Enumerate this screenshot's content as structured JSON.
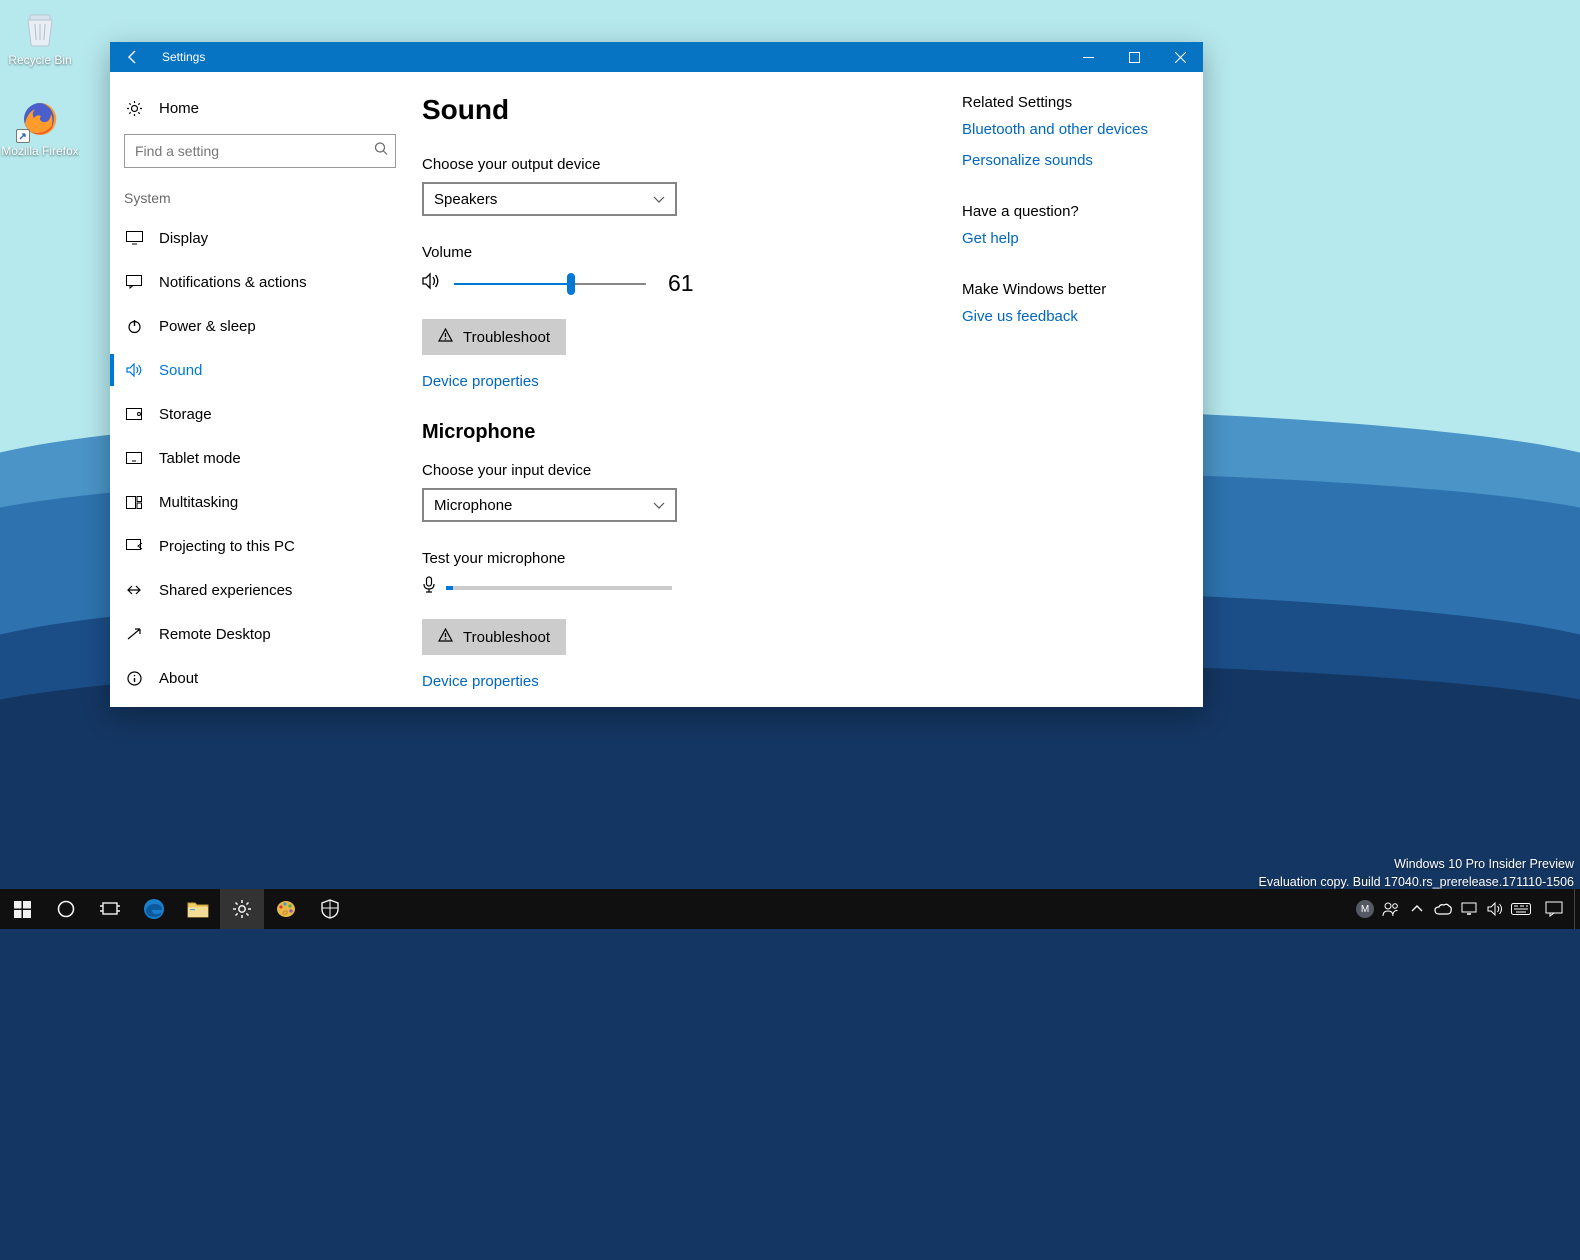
{
  "desktop": {
    "icons": {
      "recycle_bin": "Recycle Bin",
      "firefox": "Mozilla Firefox"
    },
    "watermark_line1": "Windows 10 Pro Insider Preview",
    "watermark_line2": "Evaluation copy. Build 17040.rs_prerelease.171110-1506"
  },
  "window": {
    "title": "Settings"
  },
  "sidebar": {
    "home": "Home",
    "search_placeholder": "Find a setting",
    "section": "System",
    "items": [
      {
        "label": "Display"
      },
      {
        "label": "Notifications & actions"
      },
      {
        "label": "Power & sleep"
      },
      {
        "label": "Sound"
      },
      {
        "label": "Storage"
      },
      {
        "label": "Tablet mode"
      },
      {
        "label": "Multitasking"
      },
      {
        "label": "Projecting to this PC"
      },
      {
        "label": "Shared experiences"
      },
      {
        "label": "Remote Desktop"
      },
      {
        "label": "About"
      }
    ]
  },
  "main": {
    "title": "Sound",
    "output_label": "Choose your output device",
    "output_value": "Speakers",
    "volume_label": "Volume",
    "volume_value": "61",
    "troubleshoot": "Troubleshoot",
    "device_props": "Device properties",
    "mic_heading": "Microphone",
    "input_label": "Choose your input device",
    "input_value": "Microphone",
    "test_mic": "Test your microphone"
  },
  "related": {
    "heading": "Related Settings",
    "links": [
      "Bluetooth and other devices",
      "Personalize sounds"
    ],
    "question_heading": "Have a question?",
    "help": "Get help",
    "better_heading": "Make Windows better",
    "feedback": "Give us feedback"
  },
  "taskbar": {
    "avatar_initial": "M"
  }
}
